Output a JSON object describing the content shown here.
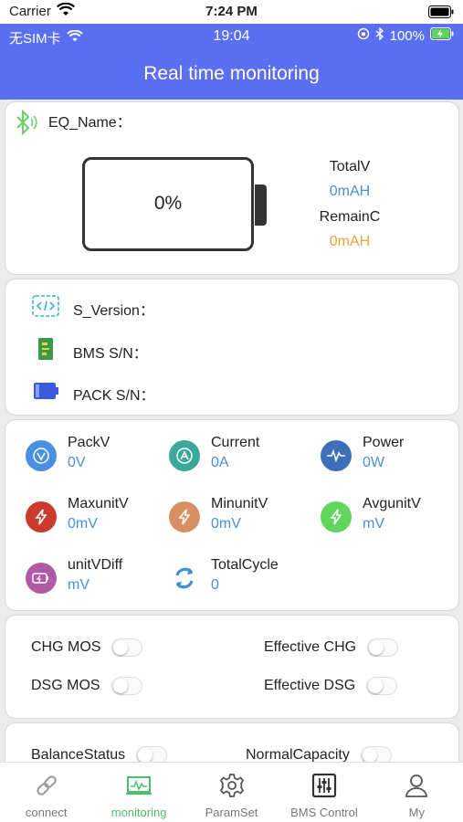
{
  "outer_status": {
    "carrier": "Carrier",
    "time": "7:24 PM"
  },
  "device_status": {
    "sim": "无SIM卡",
    "time": "19:04",
    "battery": "100%"
  },
  "header": {
    "title": "Real time monitoring"
  },
  "device": {
    "eq_name_label": "EQ_Name：",
    "percent": "0%"
  },
  "capacity": {
    "total_label": "TotalV",
    "total_value": "0mAH",
    "remain_label": "RemainC",
    "remain_value": "0mAH"
  },
  "info": {
    "s_version": "S_Version：",
    "bms_sn": "BMS S/N：",
    "pack_sn": "PACK S/N："
  },
  "metrics": [
    {
      "name": "PackV",
      "value": "0V",
      "icon": "pack-voltage-icon",
      "color": "#4a90e2"
    },
    {
      "name": "Current",
      "value": "0A",
      "icon": "current-icon",
      "color": "#3aa89a"
    },
    {
      "name": "Power",
      "value": "0W",
      "icon": "power-wave-icon",
      "color": "#3f6fb8"
    },
    {
      "name": "MaxunitV",
      "value": "0mV",
      "icon": "bolt-icon",
      "color": "#cc3a2e"
    },
    {
      "name": "MinunitV",
      "value": "0mV",
      "icon": "bolt-icon",
      "color": "#d98f64"
    },
    {
      "name": "AvgunitV",
      "value": "mV",
      "icon": "bolt-icon",
      "color": "#5fd65a"
    },
    {
      "name": "unitVDiff",
      "value": "mV",
      "icon": "battery-diff-icon",
      "color": "#b05aa6"
    },
    {
      "name": "TotalCycle",
      "value": "0",
      "icon": "cycle-icon",
      "color": "#3a8fd8"
    }
  ],
  "switches": {
    "chg_mos": "CHG MOS",
    "dsg_mos": "DSG MOS",
    "effective_chg": "Effective CHG",
    "effective_dsg": "Effective DSG",
    "balance_status": "BalanceStatus",
    "normal_capacity": "NormalCapacity"
  },
  "tabs": [
    {
      "label": "connect",
      "icon": "link-icon"
    },
    {
      "label": "monitoring",
      "icon": "monitor-icon"
    },
    {
      "label": "ParamSet",
      "icon": "gear-icon"
    },
    {
      "label": "BMS Control",
      "icon": "sliders-icon"
    },
    {
      "label": "My",
      "icon": "user-icon"
    }
  ],
  "colors": {
    "header_blue": "#5b6ff2",
    "value_blue": "#4a8fd6",
    "remain_orange": "#e8a33a",
    "active_tab": "#4bbf6b"
  }
}
